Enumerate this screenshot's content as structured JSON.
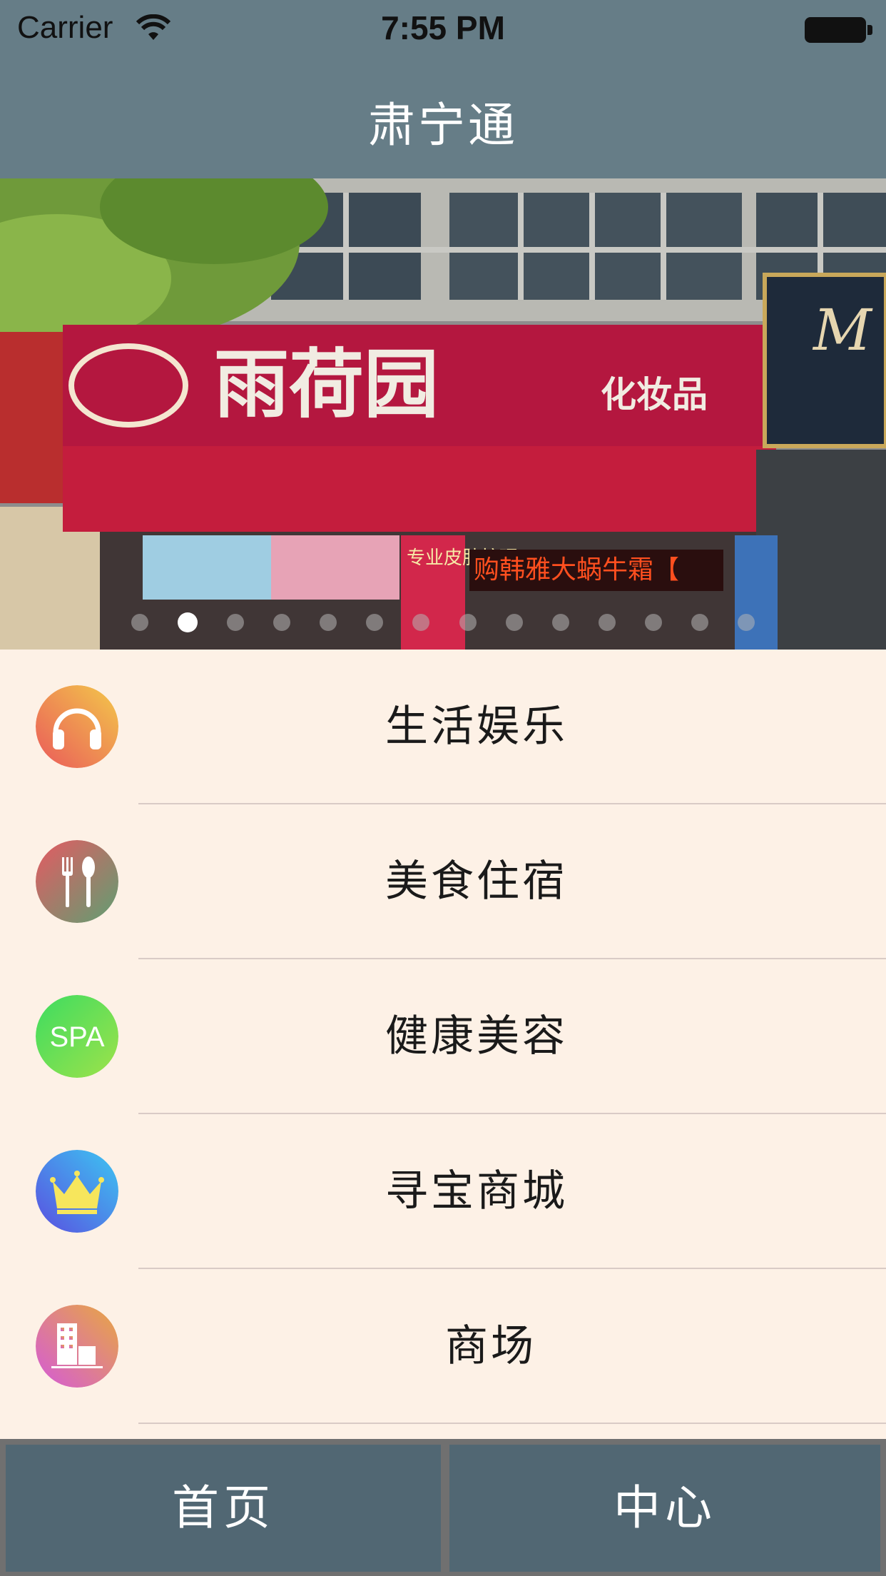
{
  "status_bar": {
    "carrier": "Carrier",
    "time": "7:55 PM"
  },
  "nav": {
    "title": "肃宁通"
  },
  "banner": {
    "sign_main": "雨荷园",
    "sign_sub": "化妆品",
    "led_text": "购韩雅大蜗牛霜【",
    "side_sign": "专业皮肤护理",
    "page_count": 14,
    "current_page": 2
  },
  "menu": {
    "items": [
      {
        "label": "生活娱乐",
        "icon": "headphones-icon",
        "colors": [
          "#ea5a5a",
          "#f3c84a"
        ]
      },
      {
        "label": "美食住宿",
        "icon": "fork-spoon-icon",
        "colors": [
          "#e55a62",
          "#5f9f72"
        ]
      },
      {
        "label": "健康美容",
        "icon": "spa-icon",
        "colors": [
          "#3ddc60",
          "#9ee24a"
        ],
        "icon_text": "SPA"
      },
      {
        "label": "寻宝商城",
        "icon": "crown-icon",
        "colors": [
          "#5a4fe0",
          "#3cc6f2"
        ]
      },
      {
        "label": "商场",
        "icon": "building-icon",
        "colors": [
          "#d55ad8",
          "#e8a840"
        ]
      }
    ]
  },
  "tabbar": {
    "home_label": "首页",
    "center_label": "中心"
  }
}
